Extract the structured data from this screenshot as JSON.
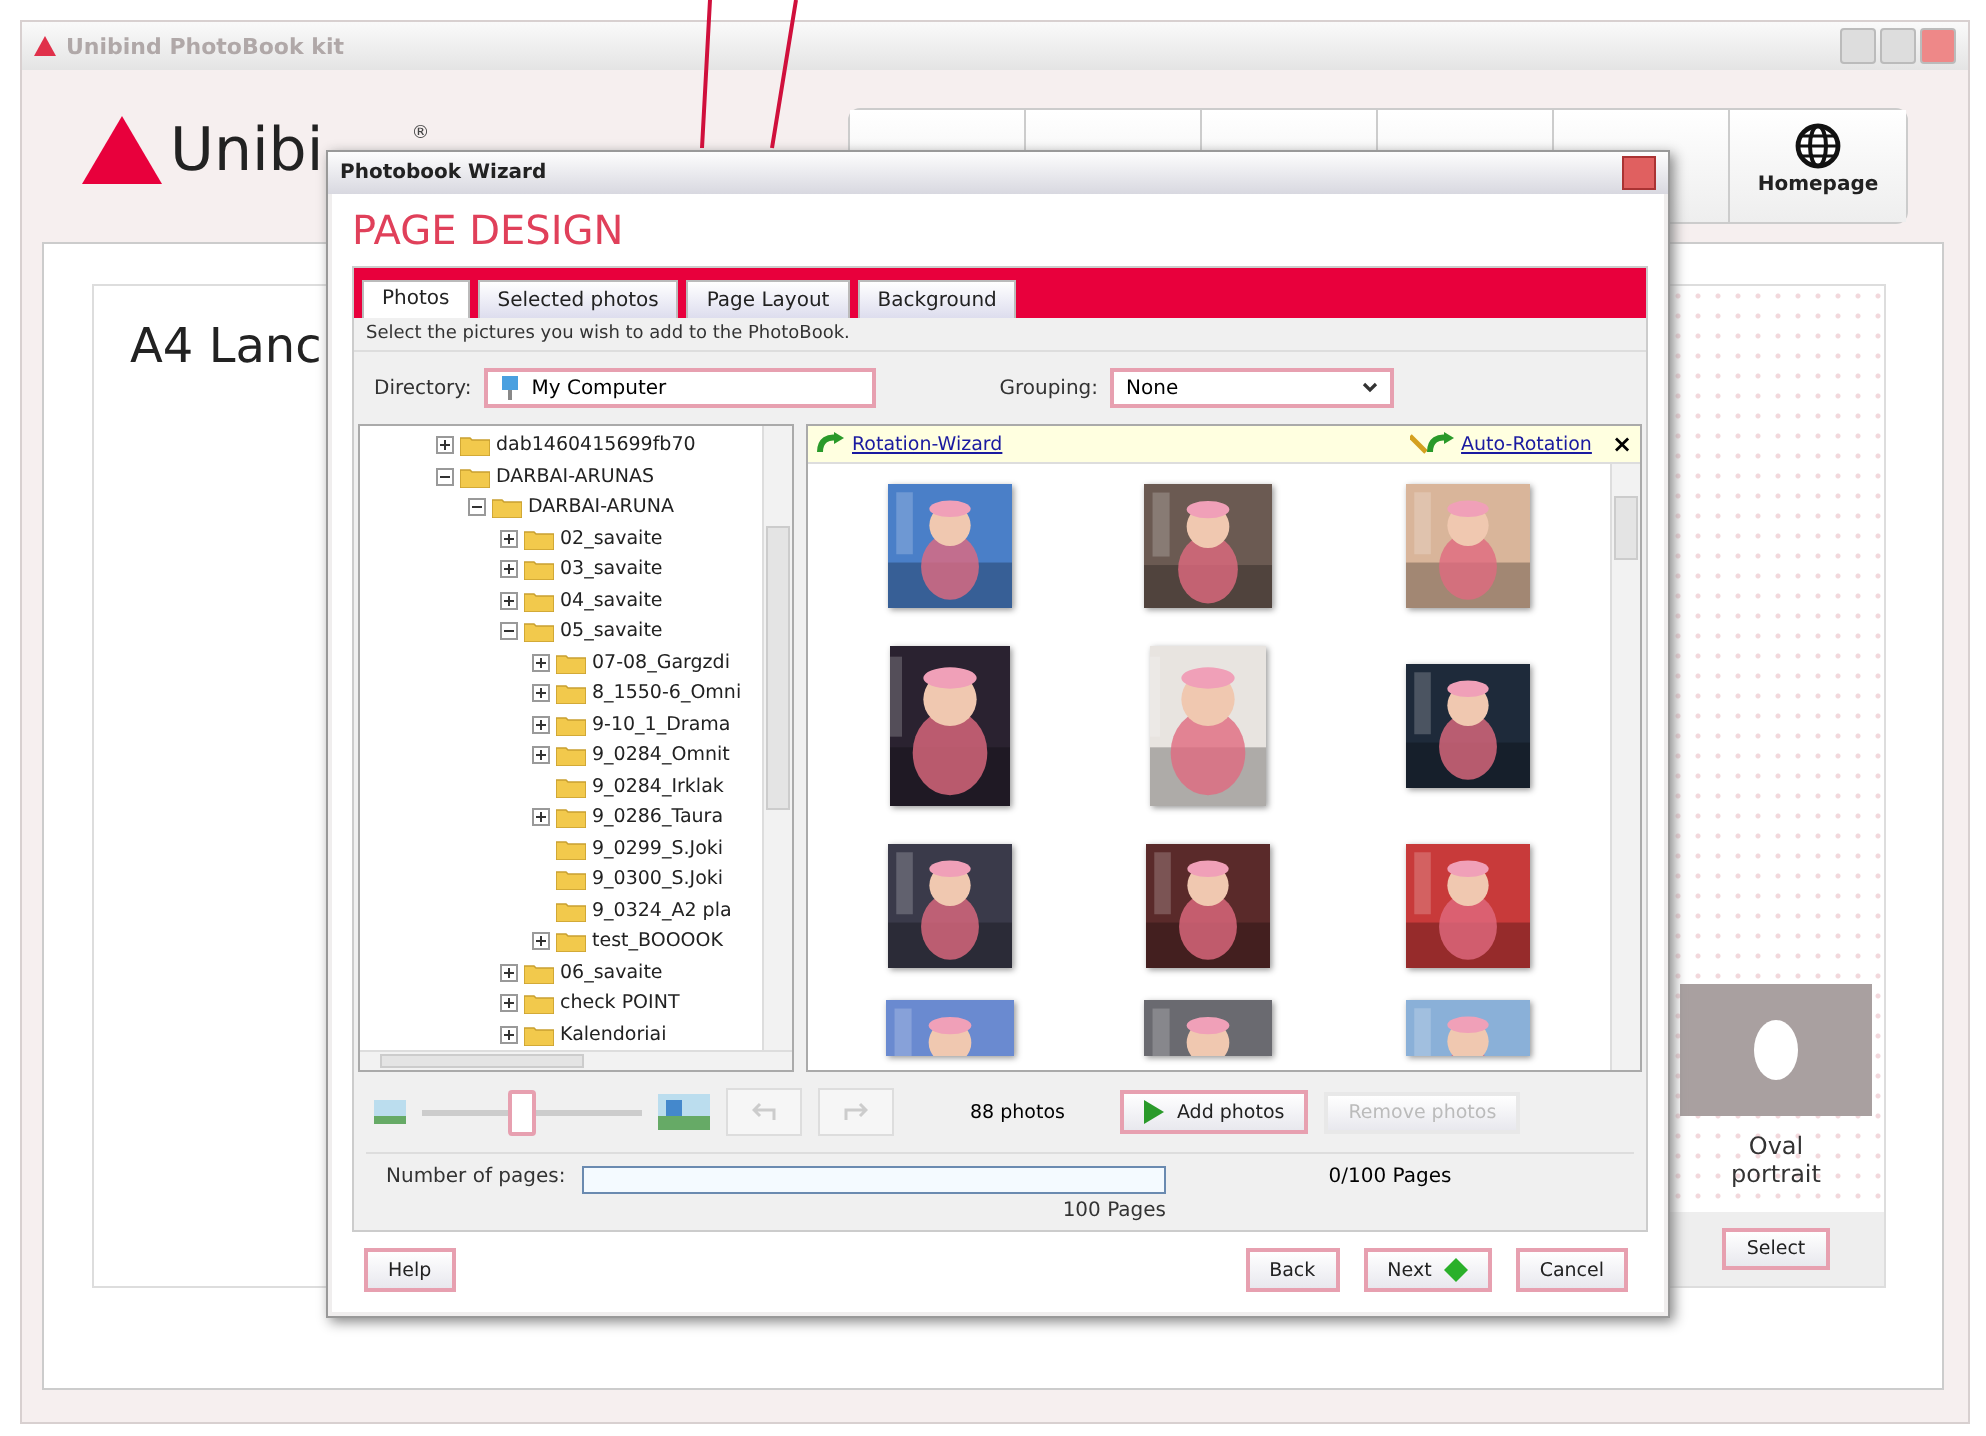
{
  "app": {
    "title": "Unibind PhotoBook kit",
    "logo": "Unibi",
    "logo_mark": "®",
    "homepage": "Homepage",
    "layout_title": "A4 Lanc",
    "layout_option": "Oval portrait",
    "select": "Select"
  },
  "dialog": {
    "title": "Photobook Wizard",
    "heading": "PAGE DESIGN",
    "tabs": [
      {
        "label": "Photos",
        "selected": true
      },
      {
        "label": "Selected photos",
        "selected": false
      },
      {
        "label": "Page Layout",
        "selected": false
      },
      {
        "label": "Background",
        "selected": false
      }
    ],
    "instruction": "Select the pictures you wish to add to the PhotoBook.",
    "directory_label": "Directory:",
    "directory": "My Computer",
    "grouping_label": "Grouping:",
    "grouping": "None",
    "tree": [
      {
        "label": "dab1460415699fb70",
        "kind": "branch",
        "expanded": false
      },
      {
        "label": "DARBAI-ARUNAS",
        "kind": "branch",
        "expanded": true,
        "children": [
          {
            "label": "DARBAI-ARUNA",
            "kind": "branch",
            "expanded": true,
            "children": [
              {
                "label": "02_savaite",
                "kind": "branch",
                "expanded": false
              },
              {
                "label": "03_savaite",
                "kind": "branch",
                "expanded": false
              },
              {
                "label": "04_savaite",
                "kind": "branch",
                "expanded": false
              },
              {
                "label": "05_savaite",
                "kind": "branch",
                "expanded": true,
                "children": [
                  {
                    "label": "07-08_Gargzdi",
                    "kind": "branch",
                    "expanded": false
                  },
                  {
                    "label": "8_1550-6_Omni",
                    "kind": "branch",
                    "expanded": false
                  },
                  {
                    "label": "9-10_1_Drama",
                    "kind": "branch",
                    "expanded": false
                  },
                  {
                    "label": "9_0284_Omnit",
                    "kind": "branch",
                    "expanded": false
                  },
                  {
                    "label": "9_0284_Irklak",
                    "kind": "leaf"
                  },
                  {
                    "label": "9_0286_Taura",
                    "kind": "branch",
                    "expanded": false
                  },
                  {
                    "label": "9_0299_S.Joki",
                    "kind": "leaf"
                  },
                  {
                    "label": "9_0300_S.Joki",
                    "kind": "leaf"
                  },
                  {
                    "label": "9_0324_A2 pla",
                    "kind": "leaf"
                  },
                  {
                    "label": "test_BOOOOK",
                    "kind": "branch",
                    "expanded": false
                  }
                ]
              },
              {
                "label": "06_savaite",
                "kind": "branch",
                "expanded": false
              },
              {
                "label": "check POINT",
                "kind": "branch",
                "expanded": false
              },
              {
                "label": "Kalendoriai",
                "kind": "branch",
                "expanded": false
              }
            ]
          }
        ]
      }
    ],
    "rotation_wizard": "Rotation-Wizard",
    "auto_rotation": "Auto-Rotation",
    "close_bar": "×",
    "zoom": {
      "level": 0.45
    },
    "photo_count": "88 photos",
    "add_photos": "Add photos",
    "remove_photos": {
      "label": "Remove photos",
      "disabled": true
    },
    "pages_label": "Number of pages:",
    "pages_max": "100 Pages",
    "pages_status": "0/100 Pages",
    "buttons": {
      "help": "Help",
      "back": "Back",
      "next": "Next",
      "cancel": "Cancel"
    }
  }
}
